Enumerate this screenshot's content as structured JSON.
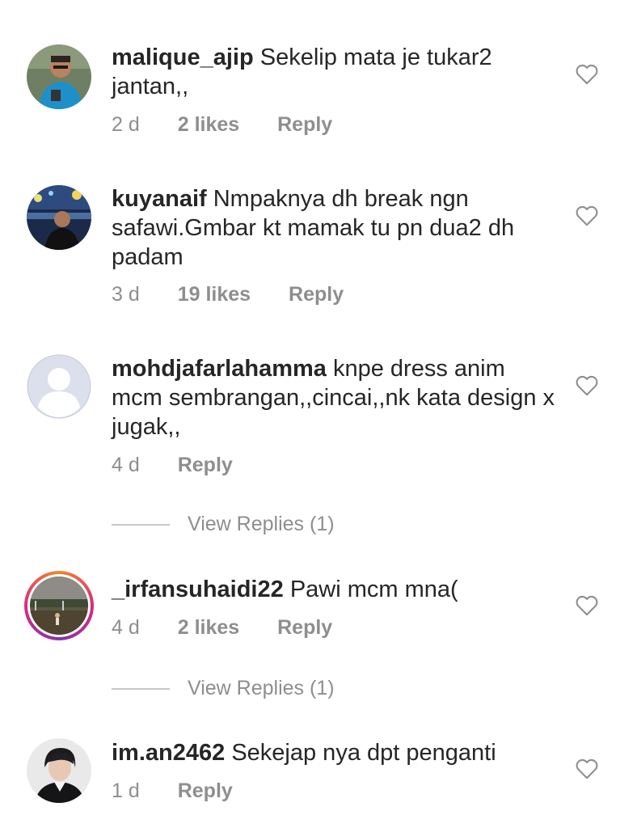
{
  "comments": [
    {
      "username": "malique_ajip",
      "text": "Sekelip mata je tukar2 jantan,,",
      "time": "2 d",
      "likes": "2 likes",
      "reply": "Reply"
    },
    {
      "username": "kuyanaif",
      "text": "Nmpaknya dh break ngn safawi.Gmbar kt mamak tu pn dua2 dh padam",
      "time": "3 d",
      "likes": "19 likes",
      "reply": "Reply"
    },
    {
      "username": "mohdjafarlahamma",
      "text": "knpe dress anim mcm sembrangan,,cincai,,nk kata design x jugak,,",
      "time": "4 d",
      "reply": "Reply",
      "view_replies": "View Replies (1)"
    },
    {
      "username": "_irfansuhaidi22",
      "text": "Pawi mcm mna(",
      "time": "4 d",
      "likes": "2 likes",
      "reply": "Reply",
      "view_replies": "View Replies (1)"
    },
    {
      "username": "im.an2462",
      "text": "Sekejap nya dpt penganti",
      "time": "1 d",
      "reply": "Reply"
    }
  ],
  "icons": {
    "heart": "heart-outline-icon",
    "avatar_default": "default-user-icon"
  },
  "colors": {
    "text": "#262626",
    "secondary": "#8e8e8e",
    "story_ring_start": "#f58529",
    "story_ring_end": "#8134af"
  }
}
